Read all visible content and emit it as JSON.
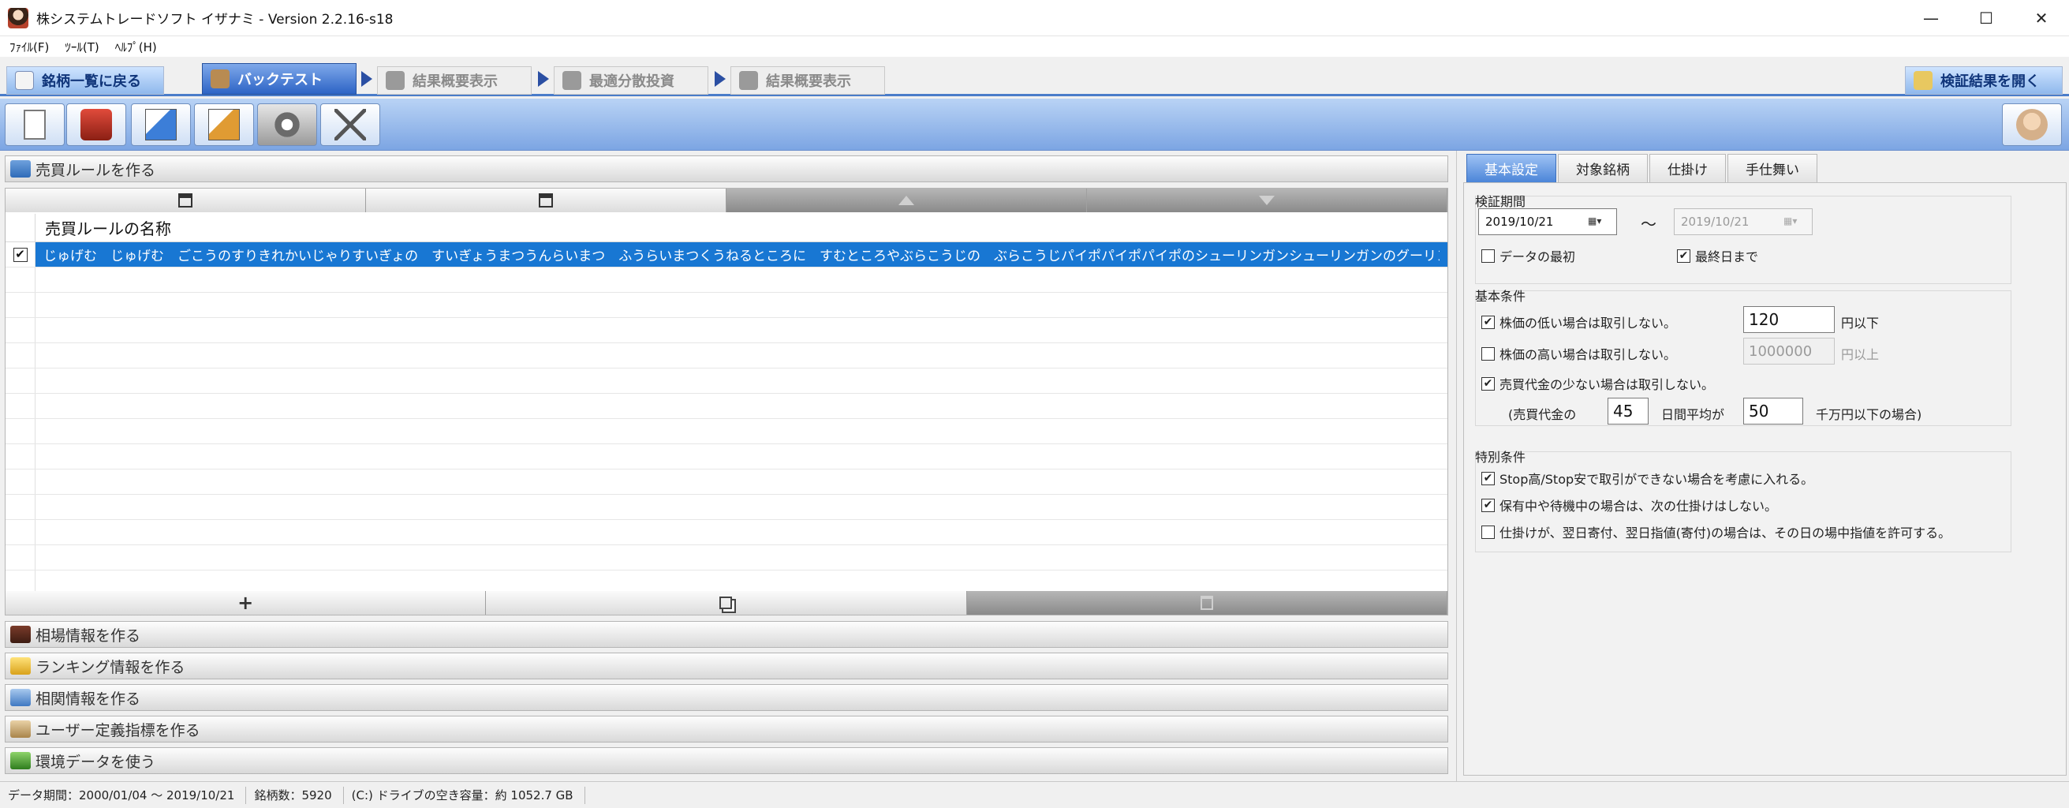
{
  "window": {
    "title": "株システムトレードソフト イザナミ - Version 2.2.16-s18",
    "controls": {
      "minimize": "—",
      "maximize": "☐",
      "close": "✕"
    }
  },
  "menu": [
    "ﾌｧｲﾙ(F)",
    "ﾂｰﾙ(T)",
    "ﾍﾙﾌﾟ(H)"
  ],
  "workflow": {
    "back": "銘柄一覧に戻る",
    "backtest": "バックテスト",
    "summary1": "結果概要表示",
    "optimize": "最適分散投資",
    "summary2": "結果概要表示",
    "open_results": "検証結果を開く"
  },
  "sections": {
    "rules": "売買ルールを作る",
    "market": "相場情報を作る",
    "ranking": "ランキング情報を作る",
    "correlation": "相関情報を作る",
    "user_indicator": "ユーザー定義指標を作る",
    "environment": "環境データを使う"
  },
  "rules_grid": {
    "column_header": "売買ルールの名称",
    "rows": [
      {
        "checked": true,
        "name": "じゅげむ　じゅげむ　ごこうのすりきれかいじゃりすいぎょの　すいぎょうまつうんらいまつ　ふうらいまつくうねるところに　すむところやぶらこうじの　ぶらこうじパイポパイポパイポのシューリンガンシューリンガンのグーリンダイグーリンダ…"
      }
    ]
  },
  "tabs": [
    "基本設定",
    "対象銘柄",
    "仕掛け",
    "手仕舞い"
  ],
  "basic_settings": {
    "period_group": "検証期間",
    "start_date": "2019/10/21",
    "tilde": "～",
    "end_date": "2019/10/21",
    "data_start": {
      "label": "データの最初",
      "checked": false
    },
    "last_day": {
      "label": "最終日まで",
      "checked": true
    },
    "basic_group": "基本条件",
    "low_price": {
      "label": "株価の低い場合は取引しない。",
      "checked": true,
      "value": "120",
      "unit": "円以下"
    },
    "high_price": {
      "label": "株価の高い場合は取引しない。",
      "checked": false,
      "value": "1000000",
      "unit": "円以上"
    },
    "low_volume": {
      "label": "売買代金の少ない場合は取引しない。",
      "checked": true
    },
    "volume_prefix": "(売買代金の",
    "volume_days": "45",
    "volume_mid": "日間平均が",
    "volume_value": "50",
    "volume_suffix": "千万円以下の場合)",
    "special_group": "特別条件",
    "stop_limit": {
      "label": "Stop高/Stop安で取引ができない場合を考慮に入れる。",
      "checked": true
    },
    "no_next_entry": {
      "label": "保有中や待機中の場合は、次の仕掛けはしない。",
      "checked": true
    },
    "allow_intraday": {
      "label": "仕掛けが、翌日寄付、翌日指値(寄付)の場合は、その日の場中指値を許可する。",
      "checked": false
    }
  },
  "status": {
    "period": "データ期間：2000/01/04 ～ 2019/10/21",
    "count": "銘柄数：5920",
    "disk": "(C:) ドライブの空き容量：約 1052.7 GB"
  },
  "colors": {
    "accent": "#2c63c5",
    "toolbar": "#7ca5e3",
    "selection": "#1877d3"
  }
}
